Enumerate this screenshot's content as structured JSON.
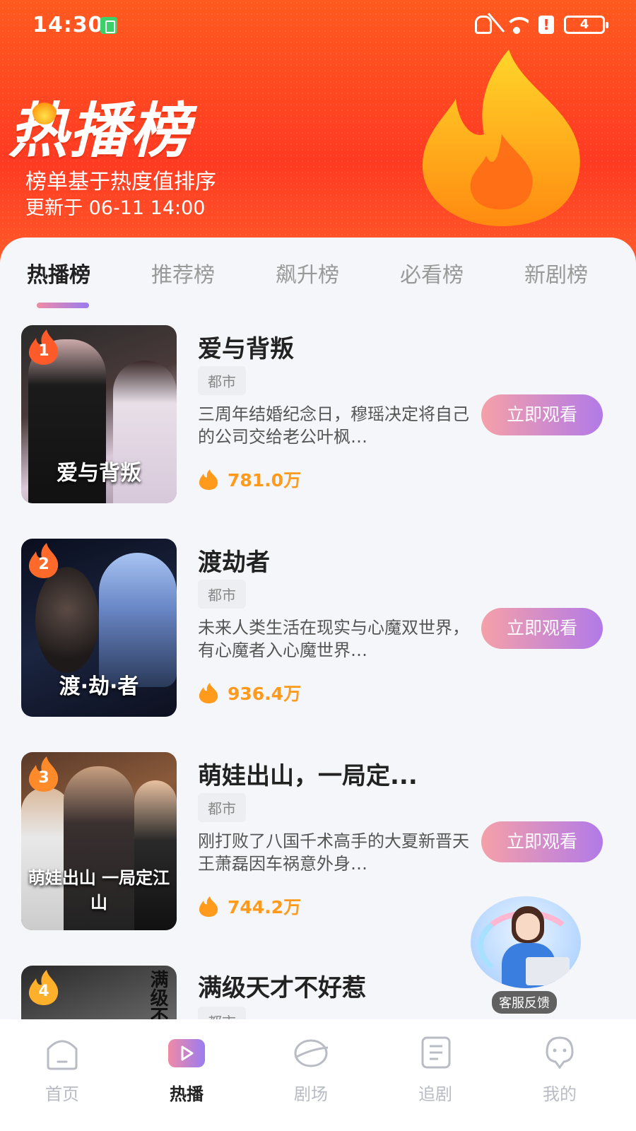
{
  "status_bar": {
    "time": "14:30",
    "battery": "4"
  },
  "header": {
    "title": "热播榜",
    "subtitle": "榜单基于热度值排序",
    "updated": "更新于 06-11 14:00"
  },
  "tabs": [
    {
      "label": "热播榜",
      "active": true
    },
    {
      "label": "推荐榜"
    },
    {
      "label": "飙升榜"
    },
    {
      "label": "必看榜"
    },
    {
      "label": "新剧榜"
    }
  ],
  "items": [
    {
      "rank": "1",
      "title": "爱与背叛",
      "poster_title": "爱与背叛",
      "tag": "都市",
      "desc": "三周年结婚纪念日，穆瑶决定将自己的公司交给老公叶枫…",
      "heat": "781.0万",
      "button": "立即观看"
    },
    {
      "rank": "2",
      "title": "渡劫者",
      "poster_title": "渡·劫·者",
      "tag": "都市",
      "desc": "未来人类生活在现实与心魔双世界，有心魔者入心魔世界…",
      "heat": "936.4万",
      "button": "立即观看"
    },
    {
      "rank": "3",
      "title": "萌娃出山，一局定...",
      "poster_title": "萌娃出山 一局定江山",
      "tag": "都市",
      "desc": "刚打败了八国千术高手的大夏新晋天王萧磊因车祸意外身…",
      "heat": "744.2万",
      "button": "立即观看"
    },
    {
      "rank": "4",
      "title": "满级天才不好惹",
      "poster_title": "满级不好惹",
      "tag": "都市"
    }
  ],
  "support": {
    "label": "客服反馈"
  },
  "nav": [
    {
      "label": "首页"
    },
    {
      "label": "热播",
      "active": true
    },
    {
      "label": "剧场"
    },
    {
      "label": "追剧"
    },
    {
      "label": "我的"
    }
  ],
  "colors": {
    "header_red": "#ff3a22",
    "heat_orange": "#ff9a1c",
    "button_gradient_start": "#f5a0a8",
    "button_gradient_end": "#b27ae8"
  }
}
